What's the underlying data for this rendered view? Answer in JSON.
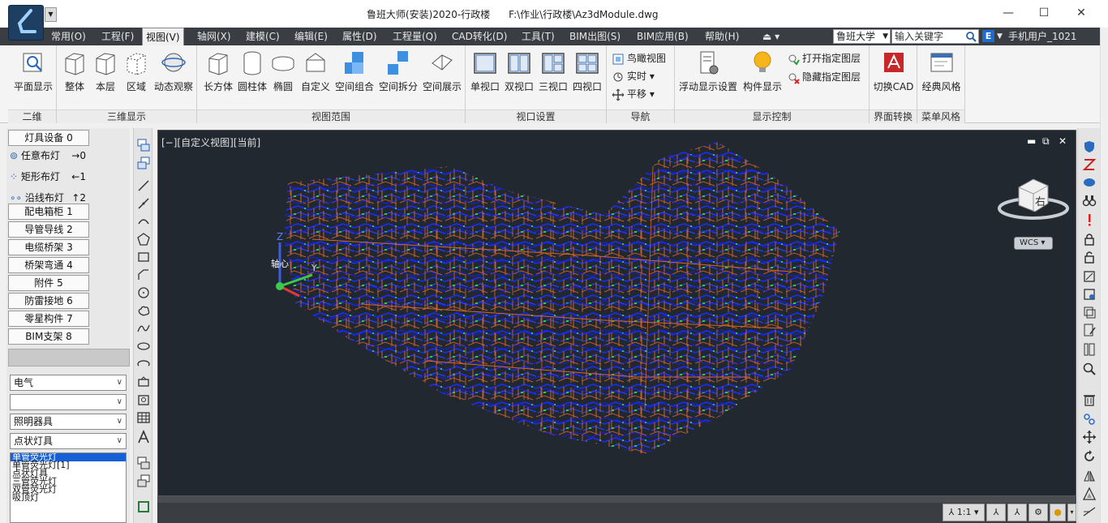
{
  "titlebar": {
    "title": "鲁班大师(安装)2020-行政楼      F:\\作业\\行政楼\\Az3dModule.dwg",
    "qa_drop": "▼",
    "min": "—",
    "max": "☐",
    "close": "✕"
  },
  "menubar": {
    "items": [
      "常用(O)",
      "工程(F)",
      "视图(V)",
      "轴网(X)",
      "建模(C)",
      "编辑(E)",
      "属性(D)",
      "工程量(Q)",
      "CAD转化(D)",
      "工具(T)",
      "BIM出图(S)",
      "BIM应用(B)",
      "帮助(H)"
    ],
    "extra_icon": "⏏ ▾",
    "account_value": "鲁班大学",
    "search_placeholder": "输入关键字",
    "user_label": "手机用户_1021",
    "dropdown_arrow": "▼"
  },
  "ribbon": {
    "groups": {
      "erwei": "二维",
      "sanwei": "三维显示",
      "fanwei": "视图范围",
      "shikou": "视口设置",
      "daohang": "导航",
      "xianshi": "显示控制",
      "jiemian": "界面转换",
      "caidan": "菜单风格"
    },
    "buttons": {
      "pingmian": "平面显示",
      "zhengti": "整体",
      "benceng": "本层",
      "quyu": "区域",
      "dongtai": "动态观察",
      "changfangti": "长方体",
      "yuanzhuti": "圆柱体",
      "tuoyuan": "椭圆",
      "zidingyi": "自定义",
      "kongjianzuhe": "空间组合",
      "kongjianchaifen": "空间拆分",
      "kongjianzhanshi": "空间展示",
      "danshikou": "单视口",
      "shuangshikou": "双视口",
      "sanshikou": "三视口",
      "sishikou": "四视口",
      "niaokan": "鸟瞰视图",
      "shishi": "实时",
      "pingyi": "平移",
      "fudong": "浮动显示设置",
      "goujian": "构件显示",
      "dakai": "打开指定图层",
      "yincang": "隐藏指定图层",
      "qiehuan": "切换CAD",
      "jingdian": "经典风格"
    },
    "small_arrow": "▾"
  },
  "leftpanel": {
    "top_button": "灯具设备  0",
    "sub_items": [
      {
        "label": "任意布灯",
        "key": "→0"
      },
      {
        "label": "矩形布灯",
        "key": "←1"
      },
      {
        "label": "沿线布灯",
        "key": "↑2"
      }
    ],
    "categories": [
      "配电箱柜  1",
      "导管导线  2",
      "电缆桥架  3",
      "桥架弯通  4",
      "附件  5",
      "防雷接地  6",
      "零星构件  7",
      "BIM支架  8"
    ],
    "selects": [
      {
        "value": "电气"
      },
      {
        "value": ""
      },
      {
        "value": "照明器具"
      },
      {
        "value": "点状灯具"
      }
    ],
    "list_items": [
      "单管荧光灯",
      "单管荧光灯[1]",
      "点状灯具",
      "三管荧光灯",
      "双管荧光灯",
      "吸顶灯"
    ],
    "arrow": "∨"
  },
  "viewport": {
    "label": "[−][自定义视图][当前]",
    "ctrl_min": "▬",
    "ctrl_restore": "⧉",
    "ctrl_close": "✕",
    "viewcube_face": "右",
    "wcs_label": "WCS ▾",
    "axis_label": "轴心",
    "axis_z": "Z",
    "axis_y": "Y"
  },
  "bottombar": {
    "scale": "1:1 ▾",
    "menu_arrow": "▾"
  },
  "colors": {
    "menubar_bg": "#3a3d42",
    "canvas_bg": "#212830",
    "model_blue": "#1a2cff",
    "model_orange": "#d4662a",
    "model_green": "#3fc94a",
    "selection_blue": "#1560d6"
  }
}
